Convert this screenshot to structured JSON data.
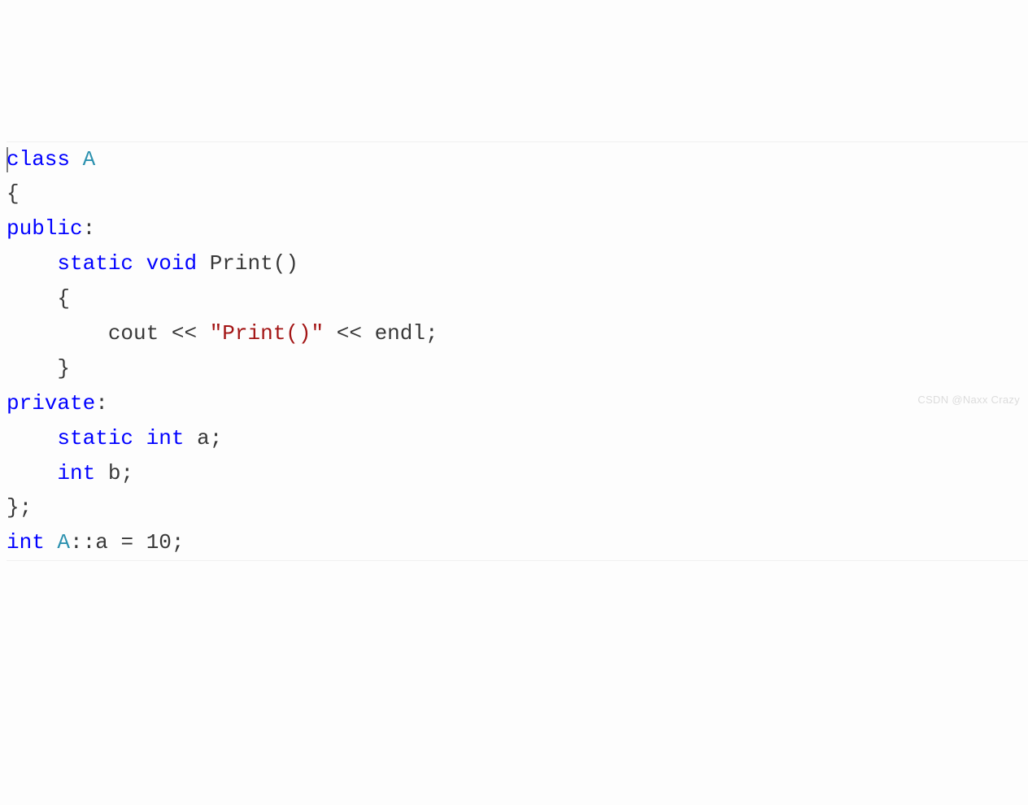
{
  "code": {
    "keyword_class": "class",
    "class_name": "A",
    "brace_open": "{",
    "access_public": "public",
    "colon": ":",
    "keyword_static1": "static",
    "keyword_void": "void",
    "method_name": "Print",
    "parens_open": "(",
    "parens_close": ")",
    "method_brace_open": "{",
    "cout": "cout",
    "stream_op1": "<<",
    "string_literal": "\"Print()\"",
    "stream_op2": "<<",
    "endl": "endl",
    "semicolon": ";",
    "method_brace_close": "}",
    "access_private": "private",
    "keyword_static2": "static",
    "type_int1": "int",
    "var_a": "a",
    "type_int2": "int",
    "var_b": "b",
    "class_brace_close": "}",
    "def_type": "int",
    "def_class": "A",
    "scope_op": "::",
    "def_var": "a",
    "assign_op": "=",
    "value_10": "10"
  },
  "watermark": "CSDN @Naxx Crazy"
}
